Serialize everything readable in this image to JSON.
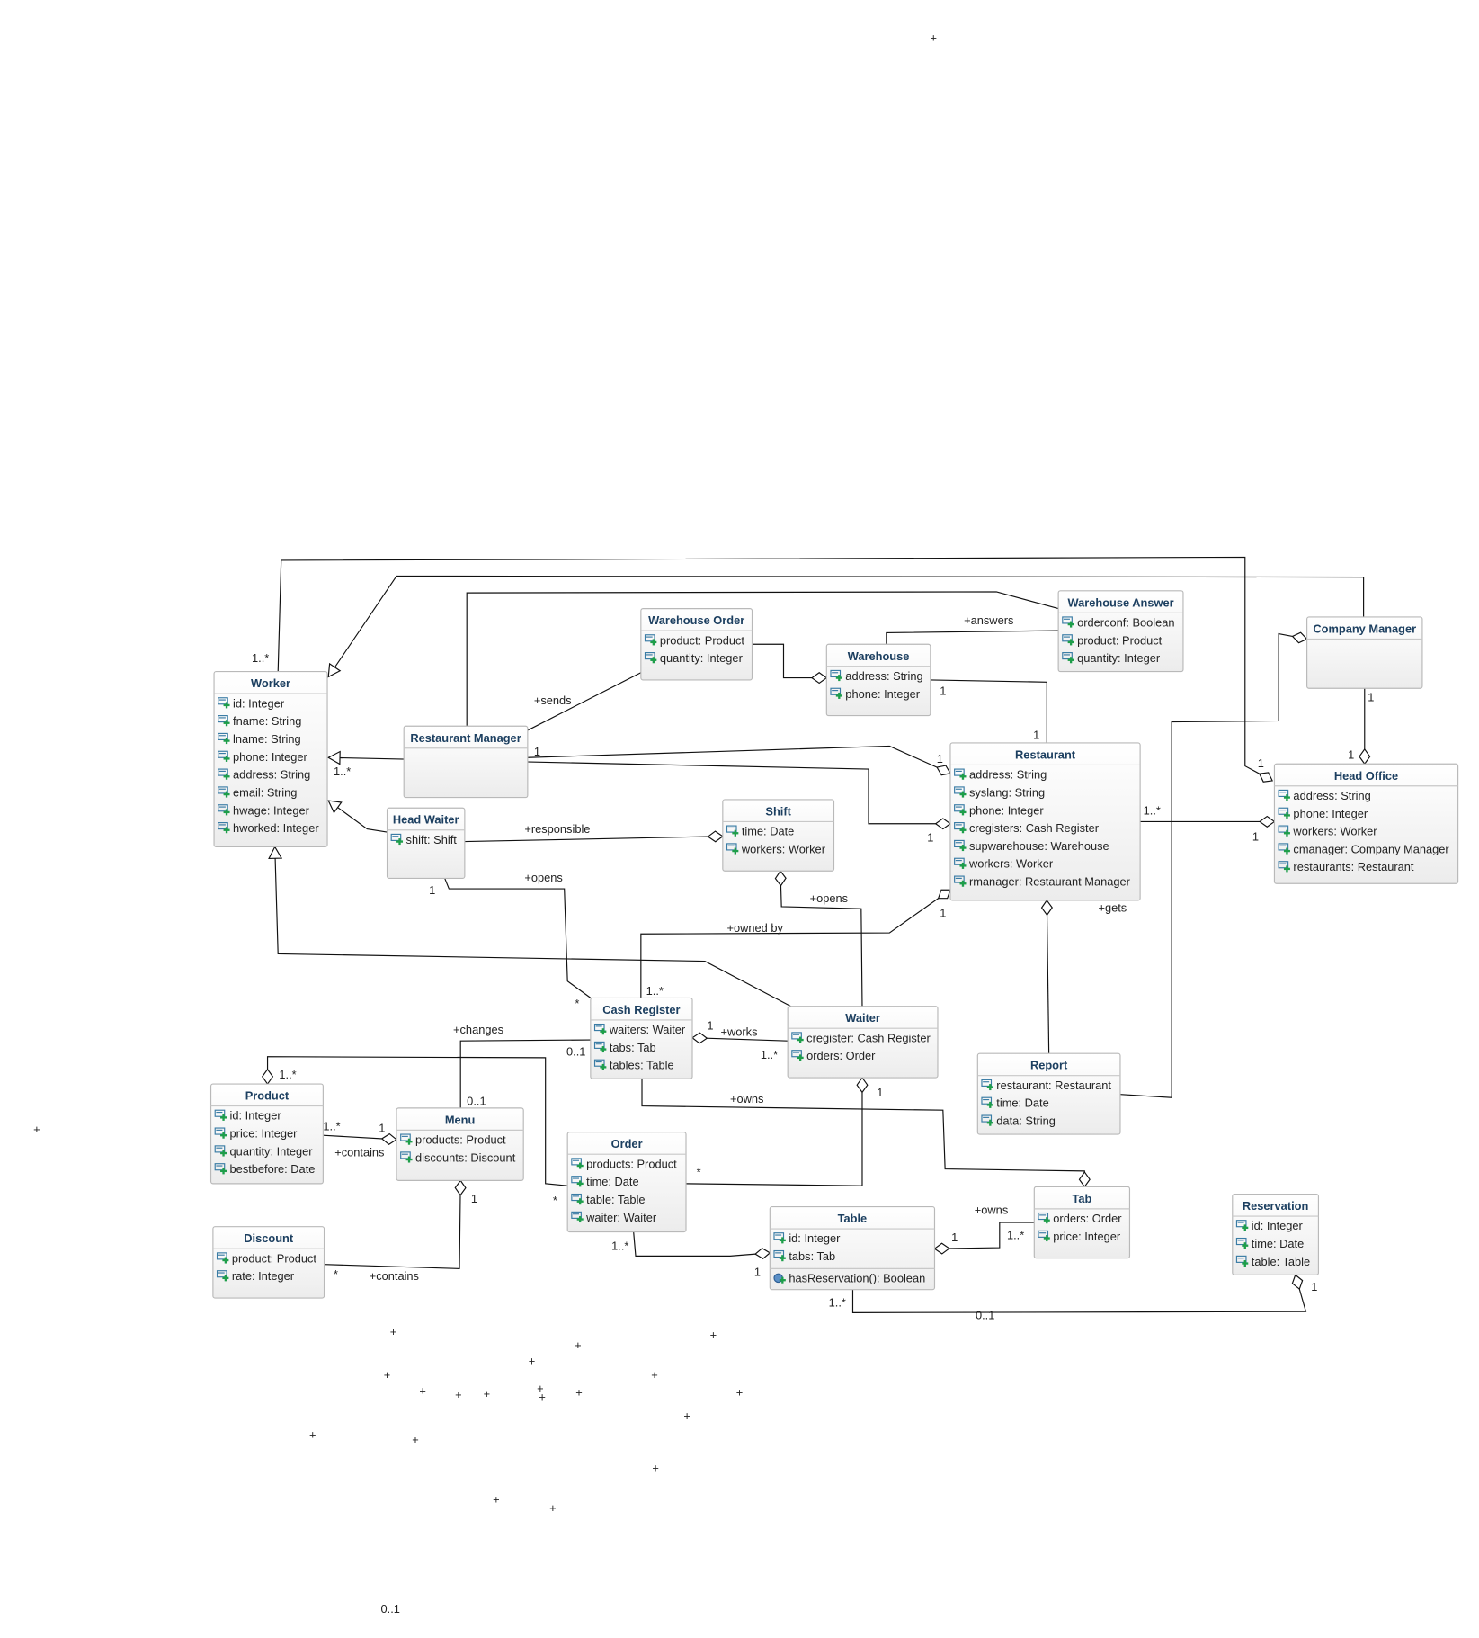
{
  "diagram": {
    "classes": [
      {
        "id": "worker",
        "name": "Worker",
        "attributes": [
          "id: Integer",
          "fname: String",
          "lname: String",
          "phone: Integer",
          "address: String",
          "email: String",
          "hwage: Integer",
          "hworked: Integer"
        ],
        "methods": []
      },
      {
        "id": "restaurant-manager",
        "name": "Restaurant Manager",
        "attributes": [],
        "methods": []
      },
      {
        "id": "head-waiter",
        "name": "Head Waiter",
        "attributes": [
          "shift: Shift"
        ],
        "methods": []
      },
      {
        "id": "warehouse-order",
        "name": "Warehouse Order",
        "attributes": [
          "product: Product",
          "quantity: Integer"
        ],
        "methods": []
      },
      {
        "id": "warehouse",
        "name": "Warehouse",
        "attributes": [
          "address: String",
          "phone: Integer"
        ],
        "methods": []
      },
      {
        "id": "warehouse-answer",
        "name": "Warehouse Answer",
        "attributes": [
          "orderconf: Boolean",
          "product: Product",
          "quantity: Integer"
        ],
        "methods": []
      },
      {
        "id": "company-manager",
        "name": "Company Manager",
        "attributes": [],
        "methods": []
      },
      {
        "id": "restaurant",
        "name": "Restaurant",
        "attributes": [
          "address: String",
          "syslang: String",
          "phone: Integer",
          "cregisters: Cash Register",
          "supwarehouse: Warehouse",
          "workers: Worker",
          "rmanager: Restaurant Manager"
        ],
        "methods": []
      },
      {
        "id": "head-office",
        "name": "Head Office",
        "attributes": [
          "address: String",
          "phone: Integer",
          "workers: Worker",
          "cmanager: Company Manager",
          "restaurants: Restaurant"
        ],
        "methods": []
      },
      {
        "id": "shift",
        "name": "Shift",
        "attributes": [
          "time: Date",
          "workers: Worker"
        ],
        "methods": []
      },
      {
        "id": "cash-register",
        "name": "Cash Register",
        "attributes": [
          "waiters: Waiter",
          "tabs: Tab",
          "tables: Table"
        ],
        "methods": []
      },
      {
        "id": "waiter",
        "name": "Waiter",
        "attributes": [
          "cregister: Cash Register",
          "orders: Order"
        ],
        "methods": []
      },
      {
        "id": "report",
        "name": "Report",
        "attributes": [
          "restaurant: Restaurant",
          "time: Date",
          "data: String"
        ],
        "methods": []
      },
      {
        "id": "product",
        "name": "Product",
        "attributes": [
          "id: Integer",
          "price: Integer",
          "quantity: Integer",
          "bestbefore: Date"
        ],
        "methods": []
      },
      {
        "id": "menu",
        "name": "Menu",
        "attributes": [
          "products: Product",
          "discounts: Discount"
        ],
        "methods": []
      },
      {
        "id": "order",
        "name": "Order",
        "attributes": [
          "products: Product",
          "time: Date",
          "table: Table",
          "waiter: Waiter"
        ],
        "methods": []
      },
      {
        "id": "discount",
        "name": "Discount",
        "attributes": [
          "product: Product",
          "rate: Integer"
        ],
        "methods": []
      },
      {
        "id": "table",
        "name": "Table",
        "attributes": [
          "id: Integer",
          "tabs: Tab"
        ],
        "methods": [
          "hasReservation(): Boolean"
        ]
      },
      {
        "id": "tab",
        "name": "Tab",
        "attributes": [
          "orders: Order",
          "price: Integer"
        ],
        "methods": []
      },
      {
        "id": "reservation",
        "name": "Reservation",
        "attributes": [
          "id: Integer",
          "time: Date",
          "table: Table"
        ],
        "methods": []
      }
    ],
    "edge_labels": [
      "1..*",
      "1",
      "+sends",
      "1",
      "1",
      "1..*",
      "1",
      "+responsible",
      "+opens",
      "1",
      "*",
      "+answers",
      "1",
      "1",
      "1..*",
      "1",
      "1",
      "1",
      "+gets",
      "+opens",
      "+owned by",
      "1",
      "1..*",
      "1",
      "+works",
      "1..*",
      "+changes",
      "0..1",
      "0..1",
      "1..*",
      "*",
      "1..*",
      "1",
      "+contains",
      "1",
      "*",
      "+contains",
      "+owns",
      "1",
      "*",
      "1..*",
      "1",
      "+owns",
      "1",
      "1..*",
      "1..*",
      "0..1",
      "1",
      "0..1"
    ],
    "marker_symbol": "+",
    "colors": {
      "title": "#1c3f60",
      "border": "#b9b9b9",
      "attr_icon": "#3a7ca5",
      "plus_icon": "#1e9e4a"
    }
  }
}
